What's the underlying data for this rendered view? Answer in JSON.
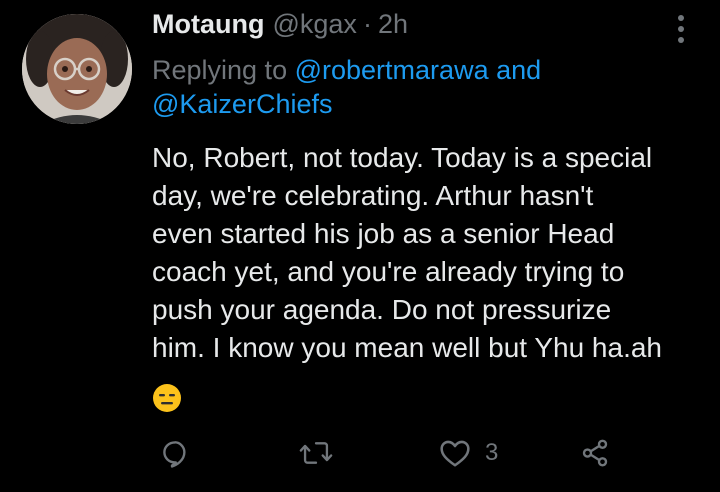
{
  "tweet": {
    "display_name": "Motaung",
    "handle": "@kgax",
    "separator": "·",
    "time": "2h",
    "replying_prefix": "Replying to",
    "replying_users": [
      "@robertmarawa",
      "@KaizerChiefs"
    ],
    "replying_joiner": "and",
    "body_lines": [
      "No, Robert, not today. Today is a special",
      "day, we're celebrating. Arthur hasn't",
      "even started his job as a senior Head",
      "coach yet, and you're already trying to",
      "push your agenda. Do not pressurize",
      "him. I know you mean well but Yhu ha.ah"
    ],
    "emoji": "expressionless-face"
  },
  "actions": {
    "reply_icon": "reply-icon",
    "retweet_icon": "retweet-icon",
    "like_icon": "heart-icon",
    "like_count": "3",
    "share_icon": "share-icon"
  },
  "colors": {
    "background": "#000000",
    "text": "#e7e9ea",
    "muted": "#71767b",
    "link": "#1d9bf0"
  }
}
